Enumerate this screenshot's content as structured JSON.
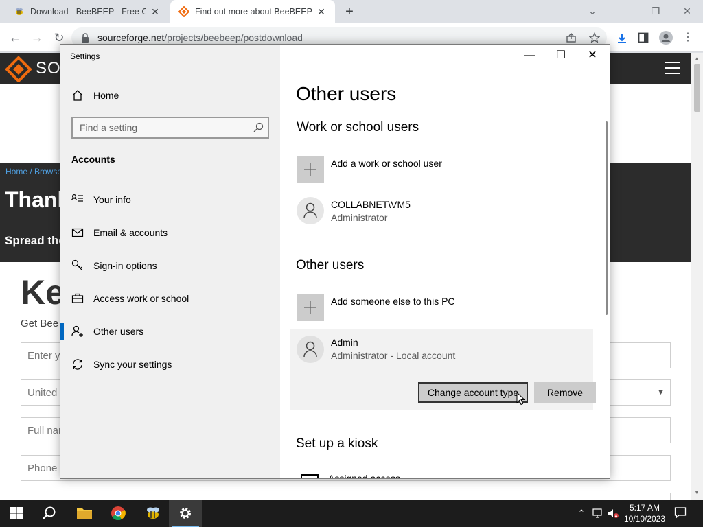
{
  "browser": {
    "tabs": [
      {
        "title": "Download - BeeBEEP - Free Offic",
        "active": false
      },
      {
        "title": "Find out more about BeeBEEP (F",
        "active": true
      }
    ],
    "url_domain": "sourceforge.net",
    "url_path": "/projects/beebeep/postdownload"
  },
  "webpage": {
    "logo_text": "SO",
    "breadcrumb": "Home / Browse",
    "heading": "Thank",
    "spread": "Spread the",
    "keep": "Ke",
    "get_bee": "Get Bee",
    "fields": {
      "email": "Enter y",
      "country": "United",
      "fullname": "Full nar",
      "phone": "Phone"
    }
  },
  "settings": {
    "window_title": "Settings",
    "nav": {
      "home": "Home",
      "search_placeholder": "Find a setting",
      "section": "Accounts",
      "items": [
        {
          "label": "Your info",
          "icon": "contact-card-icon"
        },
        {
          "label": "Email & accounts",
          "icon": "mail-icon"
        },
        {
          "label": "Sign-in options",
          "icon": "key-icon"
        },
        {
          "label": "Access work or school",
          "icon": "briefcase-icon"
        },
        {
          "label": "Other users",
          "icon": "add-person-icon",
          "active": true
        },
        {
          "label": "Sync your settings",
          "icon": "sync-icon"
        }
      ]
    },
    "panel": {
      "title": "Other users",
      "work_heading": "Work or school users",
      "add_work": "Add a work or school user",
      "work_user": {
        "name": "COLLABNET\\VM5",
        "role": "Administrator"
      },
      "other_heading": "Other users",
      "add_other": "Add someone else to this PC",
      "admin_user": {
        "name": "Admin",
        "role": "Administrator - Local account"
      },
      "change_button": "Change account type",
      "remove_button": "Remove",
      "kiosk_heading": "Set up a kiosk",
      "kiosk_item": "Assigned access"
    },
    "accent": "#0067c0"
  },
  "taskbar": {
    "time": "5:17 AM",
    "date": "10/10/2023"
  }
}
